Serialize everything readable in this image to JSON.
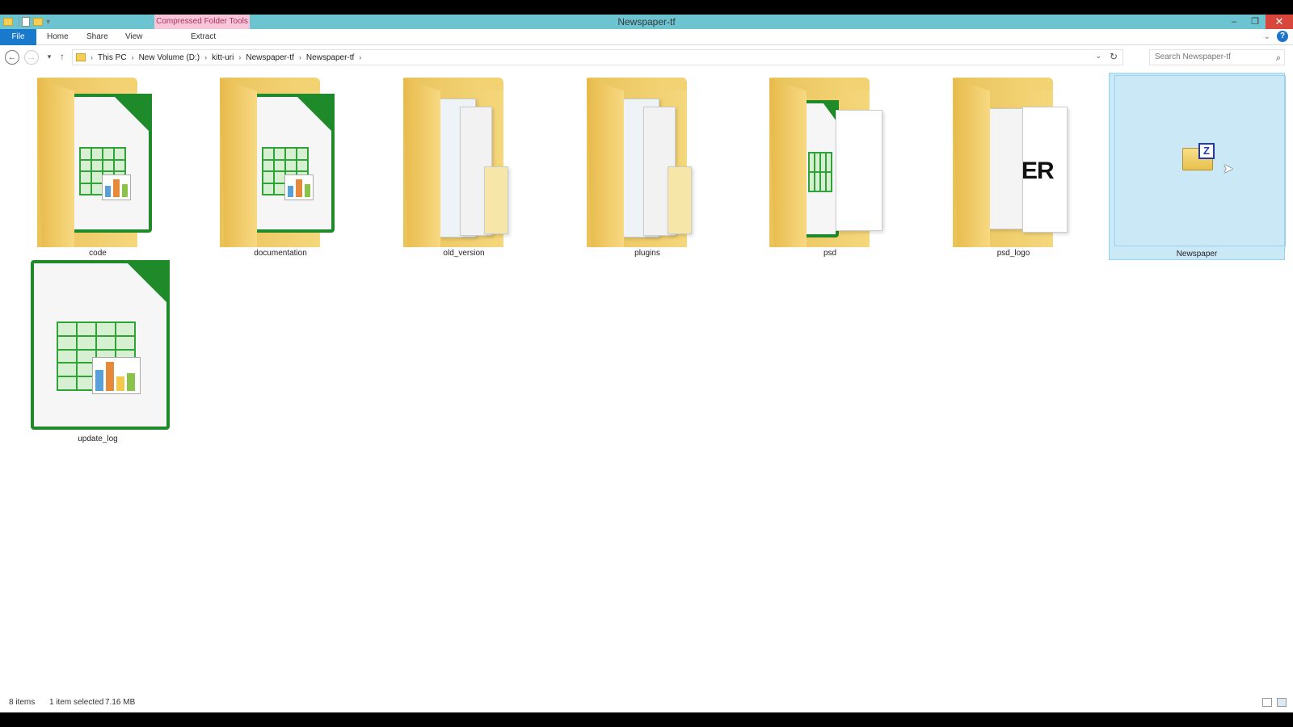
{
  "window": {
    "title": "Newspaper-tf",
    "context_tab_header": "Compressed Folder Tools",
    "controls": {
      "minimize": "–",
      "maximize": "❐",
      "close": "✕"
    }
  },
  "ribbon": {
    "tabs": [
      "File",
      "Home",
      "Share",
      "View",
      "Extract"
    ],
    "help": "?"
  },
  "address": {
    "breadcrumbs": [
      "This PC",
      "New Volume (D:)",
      "kitt-uri",
      "Newspaper-tf",
      "Newspaper-tf"
    ],
    "search_placeholder": "Search Newspaper-tf"
  },
  "items": [
    {
      "name": "code",
      "kind": "folder-calc"
    },
    {
      "name": "documentation",
      "kind": "folder-calc"
    },
    {
      "name": "old_version",
      "kind": "folder-papers"
    },
    {
      "name": "plugins",
      "kind": "folder-papers"
    },
    {
      "name": "psd",
      "kind": "folder-calc-paper"
    },
    {
      "name": "psd_logo",
      "kind": "folder-logo"
    },
    {
      "name": "Newspaper",
      "kind": "zip",
      "selected": true
    },
    {
      "name": "update_log",
      "kind": "calc-file"
    }
  ],
  "zip_badge": "Z",
  "logo_text": "ER",
  "status": {
    "count": "8 items",
    "selected": "1 item selected",
    "size": "7.16 MB"
  },
  "colors": {
    "titlebar": "#6cc4d0",
    "file_tab": "#1979ca",
    "selection": "#cbe8f6",
    "calc_green": "#1f8a2a"
  }
}
